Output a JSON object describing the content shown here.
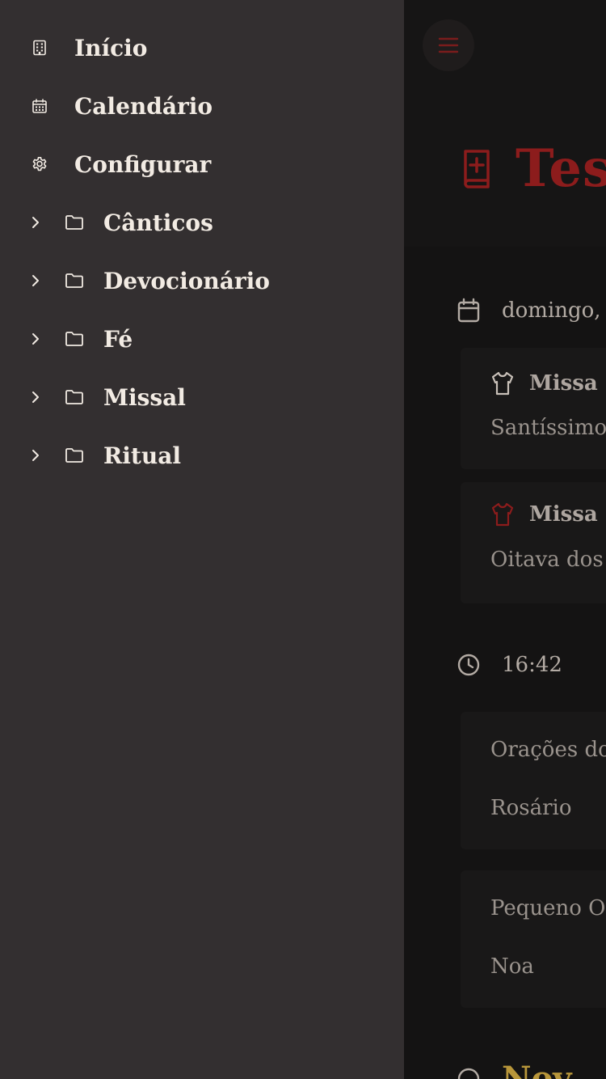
{
  "drawer": {
    "top_items": [
      {
        "label": "Início",
        "icon": "building-icon"
      },
      {
        "label": "Calendário",
        "icon": "calendar-icon"
      },
      {
        "label": "Configurar",
        "icon": "gear-icon"
      }
    ],
    "folders": [
      {
        "label": "Cânticos"
      },
      {
        "label": "Devocionário"
      },
      {
        "label": "Fé"
      },
      {
        "label": "Missal"
      },
      {
        "label": "Ritual"
      }
    ]
  },
  "main": {
    "title": "Tes",
    "date_text": "domingo,",
    "masses": [
      {
        "label": "Missa",
        "separator": "|",
        "subtitle": "Santíssimo",
        "vestment_color": "#c8c0b8"
      },
      {
        "label": "Missa",
        "separator": "|",
        "subtitle": "Oitava dos",
        "vestment_color": "#8c1c1c"
      }
    ],
    "time_text": "16:42",
    "prayer_card_1": [
      "Orações do",
      "Rosário"
    ],
    "prayer_card_2": [
      "Pequeno Of",
      "Noa"
    ],
    "bottom_partial": "Nov"
  },
  "colors": {
    "drawer_bg": "#332f30",
    "main_bg": "#141313",
    "accent_red": "#8c1c1c",
    "drawer_text": "#f2ebe3",
    "gold": "#b8963a"
  }
}
